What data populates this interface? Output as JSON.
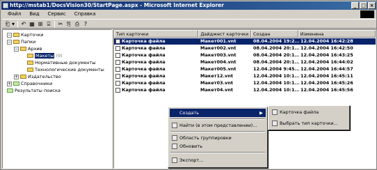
{
  "window": {
    "title": "http://mstab1/DocsVision30/StartPage.aspx - Microsoft Internet Explorer",
    "btn_min": "_",
    "btn_max": "□",
    "btn_close": "×"
  },
  "menu": {
    "items": [
      "Файл",
      "Вид",
      "Сервис",
      "Справка"
    ]
  },
  "toolbar": {
    "new": "⎗",
    "new_arrow": "▾",
    "t2": "↶",
    "t3": "▦",
    "t4": "⊞",
    "t5": "⌸",
    "t6": "✂",
    "t7": "⎘",
    "t8": "⎙",
    "t9": "?"
  },
  "tree": {
    "nodes": [
      {
        "label": "Карточки",
        "exp": "−"
      },
      {
        "label": "Папки",
        "exp": "−"
      },
      {
        "label": "Архив",
        "exp": "−"
      },
      {
        "label": "Макеты",
        "badge": "(9)"
      },
      {
        "label": "Нормативные документы",
        "exp": ""
      },
      {
        "label": "Технологические документы",
        "exp": ""
      },
      {
        "label": "Издательство",
        "exp": "+"
      },
      {
        "label": "Справочники",
        "exp": "+"
      },
      {
        "label": "Результаты поиска",
        "exp": ""
      }
    ]
  },
  "table": {
    "headers": [
      "Тип карточки",
      "Дайджест карточки",
      "Создан",
      "Изменена"
    ],
    "rows": [
      [
        "Карточка файла",
        "Макет001.vnt",
        "08.04.2004 19:2...",
        "12.04.2004 16:42:28"
      ],
      [
        "Карточка файла",
        "Макет002.vnt",
        "08.04.2004 20:1...",
        "12.04.2004 16:42:50"
      ],
      [
        "Карточка файла",
        "Макет003.vnt",
        "08.04.2004 20:1...",
        "12.04.2004 16:43:25"
      ],
      [
        "Карточка файла",
        "Макет004.vnt",
        "08.04.2004 20:1...",
        "12.04.2004 16:44:02"
      ],
      [
        "Карточка файла",
        "Макет005.vnt",
        "12.04.2004 9:45...",
        "12.04.2004 16:44:57"
      ],
      [
        "Карточка файла",
        "Макет12.vnt",
        "12.04.2004 10:1...",
        "12.04.2004 16:45:11"
      ],
      [
        "Карточка файла",
        "Макет03.vnt",
        "12.04.2004 10:1...",
        "12.04.2004 16:45:26"
      ],
      [
        "Карточка файла",
        "Макет04.vnt",
        "12.04.2004 10:1...",
        "12.04.2004 16:45:56"
      ]
    ]
  },
  "context_menu": {
    "create": "Создать",
    "arrow": "▶",
    "find": "Найти (в этом представлении)...",
    "grouping": "Область группировки",
    "refresh": "Обновить",
    "export": "Экспорт..."
  },
  "submenu": {
    "file_card": "Карточка файла",
    "choose_type": "Выбрать тип карточки..."
  }
}
